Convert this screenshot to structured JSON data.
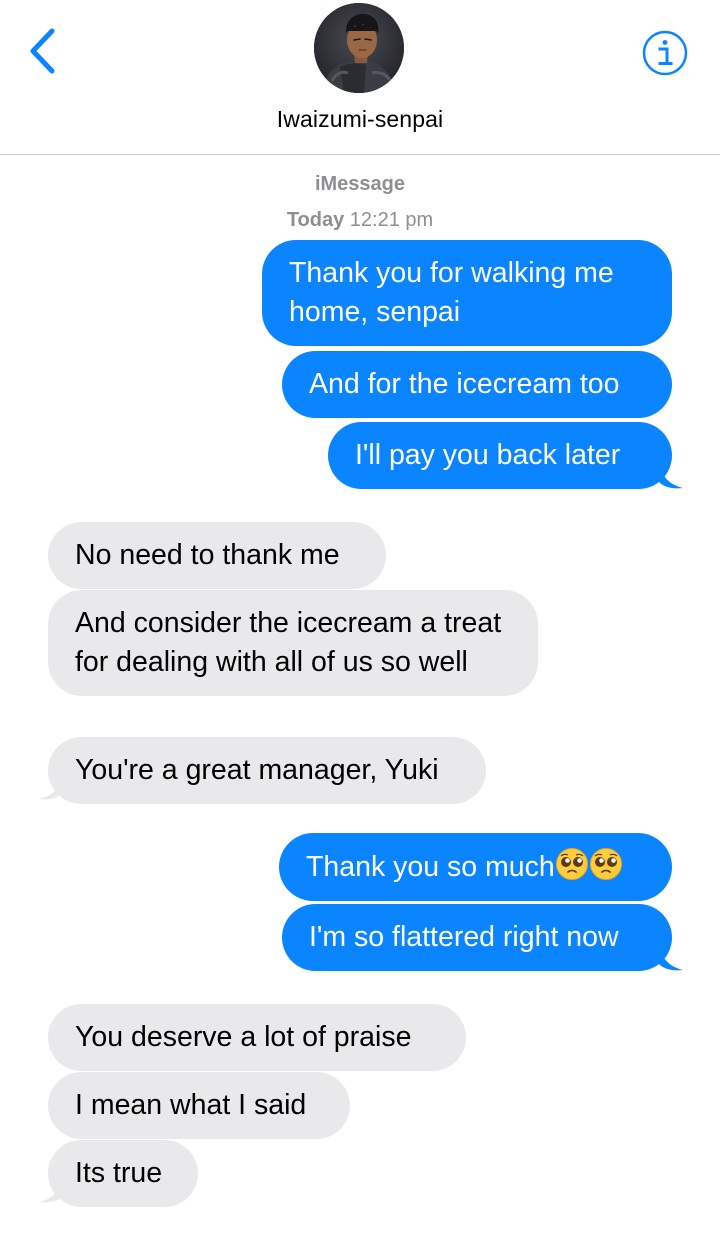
{
  "header": {
    "back_icon": "chevron-left-icon",
    "info_icon": "info-circle-icon",
    "contact_name": "Iwaizumi-senpai",
    "accent_color": "#0b84ff"
  },
  "thread": {
    "service": "iMessage",
    "timestamp_day": "Today",
    "timestamp_time": "12:21 pm"
  },
  "colors": {
    "sent_bubble": "#0b84ff",
    "received_bubble": "#e9e9eb",
    "meta_text": "#8e8e93"
  },
  "messages": [
    {
      "direction": "sent",
      "text": "Thank you for walking me home, senpai"
    },
    {
      "direction": "sent",
      "text": "And for the icecream too"
    },
    {
      "direction": "sent",
      "text": "I'll pay you back later"
    },
    {
      "direction": "received",
      "text": "No need to thank me"
    },
    {
      "direction": "received",
      "text": "And consider the icecream a treat for dealing with all of us so well"
    },
    {
      "direction": "received",
      "text": "You're a great manager, Yuki"
    },
    {
      "direction": "sent",
      "text": "Thank you so much",
      "emoji": [
        "pleading-face-emoji",
        "pleading-face-emoji"
      ]
    },
    {
      "direction": "sent",
      "text": "I'm so flattered right now"
    },
    {
      "direction": "received",
      "text": "You deserve a lot of praise"
    },
    {
      "direction": "received",
      "text": "I mean what I said"
    },
    {
      "direction": "received",
      "text": "Its true"
    }
  ]
}
